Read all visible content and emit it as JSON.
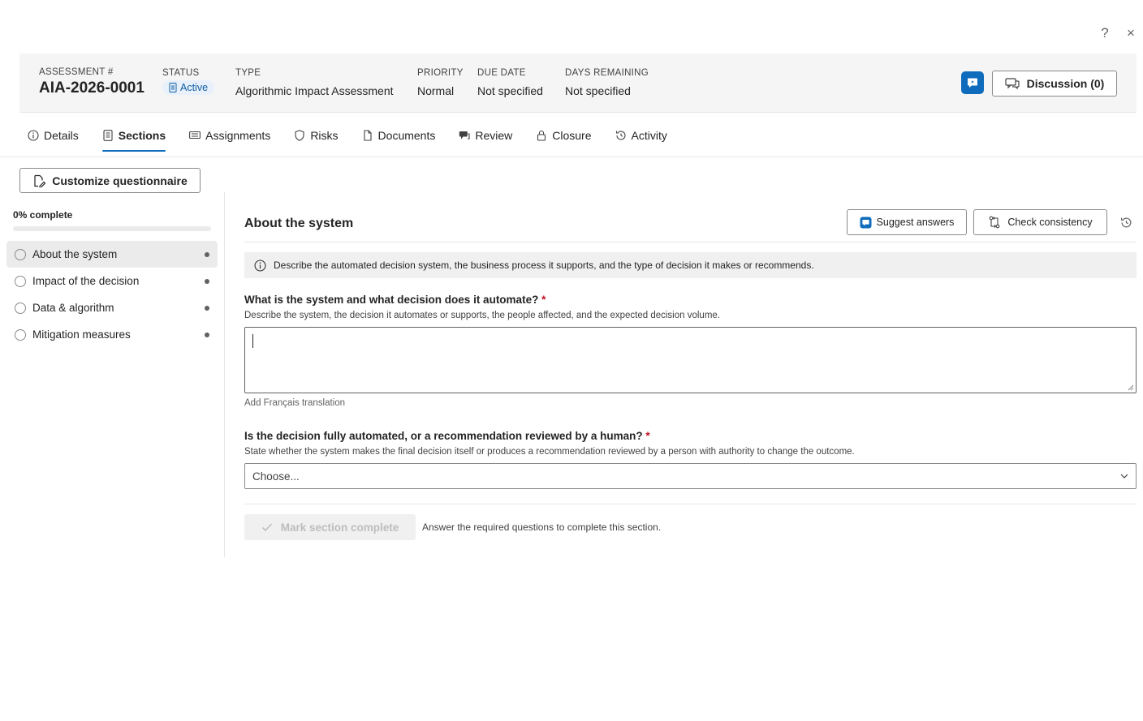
{
  "top_bar": {
    "help_label": "?",
    "close_label": "×"
  },
  "header": {
    "assessment": {
      "label": "ASSESSMENT #",
      "value": "AIA-2026-0001"
    },
    "status": {
      "label": "STATUS",
      "value": "Active"
    },
    "type": {
      "label": "TYPE",
      "value": "Algorithmic Impact Assessment"
    },
    "priority": {
      "label": "PRIORITY",
      "value": "Normal"
    },
    "due_date": {
      "label": "DUE DATE",
      "value": "Not specified"
    },
    "days_remaining": {
      "label": "DAYS REMAINING",
      "value": "Not specified"
    },
    "discussion_label": "Discussion (0)"
  },
  "tabs": [
    {
      "label": "Details",
      "icon": "info-icon"
    },
    {
      "label": "Sections",
      "icon": "document-list-icon",
      "active": true
    },
    {
      "label": "Assignments",
      "icon": "keyboard-icon"
    },
    {
      "label": "Risks",
      "icon": "shield-icon"
    },
    {
      "label": "Documents",
      "icon": "document-copy-icon"
    },
    {
      "label": "Review",
      "icon": "chat-multiple-icon"
    },
    {
      "label": "Closure",
      "icon": "lock-icon"
    },
    {
      "label": "Activity",
      "icon": "history-icon"
    }
  ],
  "sidebar": {
    "customize_label": "Customize questionnaire",
    "progress_label": "0% complete",
    "progress_value": 0,
    "sections": [
      {
        "label": "About the system",
        "active": true
      },
      {
        "label": "Impact of the decision"
      },
      {
        "label": "Data & algorithm"
      },
      {
        "label": "Mitigation measures"
      }
    ]
  },
  "main": {
    "section_title": "About the system",
    "suggest_label": "Suggest answers",
    "check_label": "Check consistency",
    "info_text": "Describe the automated decision system, the business process it supports, and the type of decision it makes or recommends.",
    "q1": {
      "label": "What is the system and what decision does it automate?",
      "required_mark": "*",
      "help": "Describe the system, the decision it automates or supports, the people affected, and the expected decision volume.",
      "value": "",
      "add_translation": "Add Français translation"
    },
    "q2": {
      "label": "Is the decision fully automated, or a recommendation reviewed by a human?",
      "required_mark": "*",
      "help": "State whether the system makes the final decision itself or produces a recommendation reviewed by a person with authority to change the outcome.",
      "selected": "Choose..."
    },
    "mark_complete_label": "Mark section complete",
    "mark_complete_hint": "Answer the required questions to complete this section."
  },
  "colors": {
    "accent": "#0f6cbd",
    "required": "#c50f1f",
    "status_bg": "#e8f1fb"
  }
}
